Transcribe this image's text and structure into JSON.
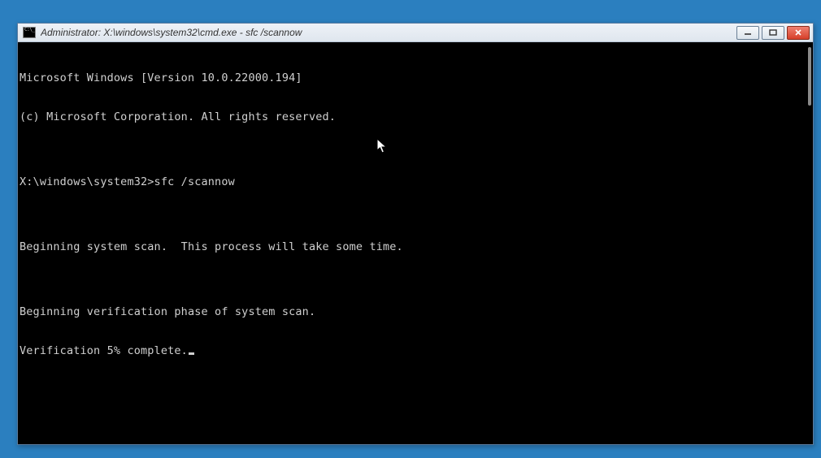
{
  "window": {
    "title": "Administrator: X:\\windows\\system32\\cmd.exe - sfc  /scannow"
  },
  "console": {
    "lines": [
      "Microsoft Windows [Version 10.0.22000.194]",
      "(c) Microsoft Corporation. All rights reserved.",
      "",
      "X:\\windows\\system32>sfc /scannow",
      "",
      "Beginning system scan.  This process will take some time.",
      "",
      "Beginning verification phase of system scan.",
      "Verification 5% complete."
    ],
    "progress_percent": 5
  },
  "colors": {
    "desktop": "#2b7fbf",
    "console_bg": "#000000",
    "console_fg": "#d0d0d0",
    "close_btn": "#d6402a"
  }
}
